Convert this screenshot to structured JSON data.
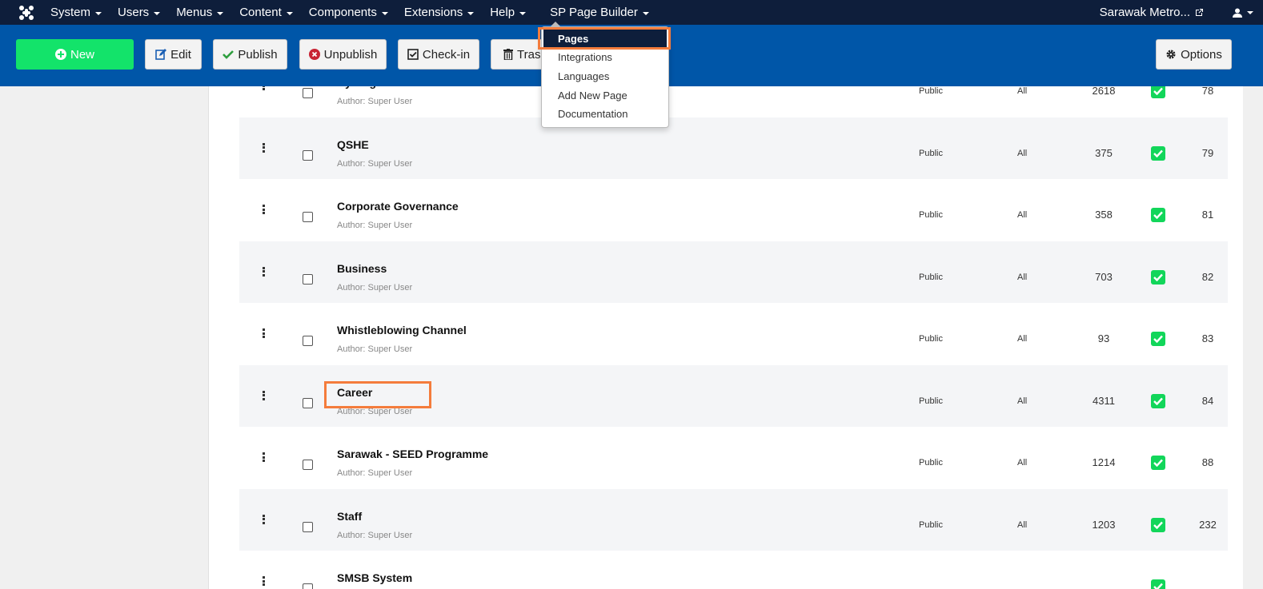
{
  "navbar": {
    "items": [
      {
        "label": "System"
      },
      {
        "label": "Users"
      },
      {
        "label": "Menus"
      },
      {
        "label": "Content"
      },
      {
        "label": "Components"
      },
      {
        "label": "Extensions"
      },
      {
        "label": "Help"
      }
    ],
    "sp_page_builder": "SP Page Builder",
    "site_link": "Sarawak Metro..."
  },
  "toolbar": {
    "new": "New",
    "edit": "Edit",
    "publish": "Publish",
    "unpublish": "Unpublish",
    "checkin": "Check-in",
    "trash": "Trash",
    "options": "Options"
  },
  "dropdown": {
    "items": [
      "Pages",
      "Integrations",
      "Languages",
      "Add New Page",
      "Documentation"
    ],
    "active": "Pages"
  },
  "rows": [
    {
      "title": "Hydrogen Tech",
      "author": "Author: Super User",
      "access": "Public",
      "language": "All",
      "hits": "2618",
      "published": true,
      "id": "78"
    },
    {
      "title": "QSHE",
      "author": "Author: Super User",
      "access": "Public",
      "language": "All",
      "hits": "375",
      "published": true,
      "id": "79"
    },
    {
      "title": "Corporate Governance",
      "author": "Author: Super User",
      "access": "Public",
      "language": "All",
      "hits": "358",
      "published": true,
      "id": "81"
    },
    {
      "title": "Business",
      "author": "Author: Super User",
      "access": "Public",
      "language": "All",
      "hits": "703",
      "published": true,
      "id": "82"
    },
    {
      "title": "Whistleblowing Channel",
      "author": "Author: Super User",
      "access": "Public",
      "language": "All",
      "hits": "93",
      "published": true,
      "id": "83"
    },
    {
      "title": "Career",
      "author": "Author: Super User",
      "access": "Public",
      "language": "All",
      "hits": "4311",
      "published": true,
      "id": "84"
    },
    {
      "title": "Sarawak - SEED Programme",
      "author": "Author: Super User",
      "access": "Public",
      "language": "All",
      "hits": "1214",
      "published": true,
      "id": "88"
    },
    {
      "title": "Staff",
      "author": "Author: Super User",
      "access": "Public",
      "language": "All",
      "hits": "1203",
      "published": true,
      "id": "232"
    },
    {
      "title": "SMSB System",
      "author": "",
      "access": "",
      "language": "",
      "hits": "",
      "published": true,
      "id": ""
    }
  ],
  "colors": {
    "navbar": "#0e1e3b",
    "toolbar": "#0056a8",
    "new_button": "#13e36a",
    "published_check": "#12d65a",
    "highlight": "#f47c3c"
  }
}
